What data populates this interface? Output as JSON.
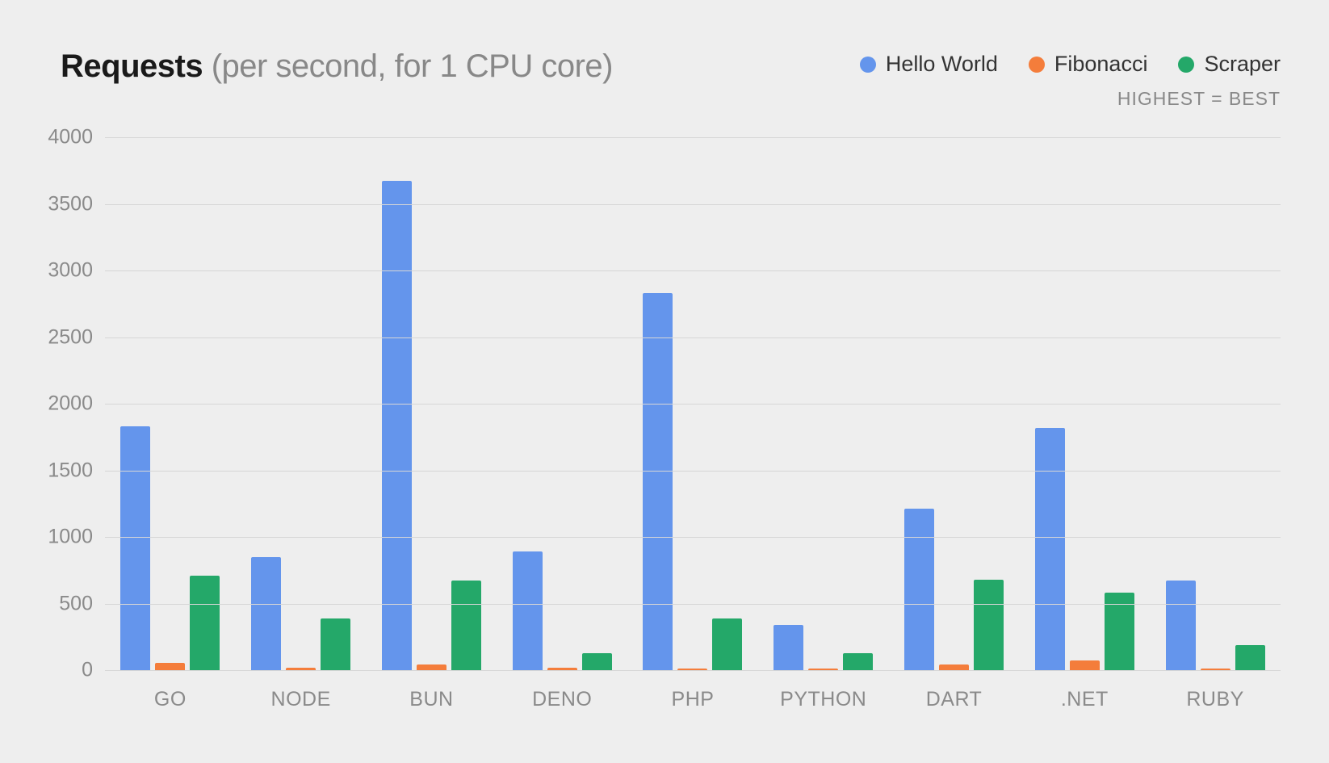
{
  "title": {
    "main": "Requests",
    "sub": "(per second, for 1 CPU core)"
  },
  "legend_note": "HIGHEST = BEST",
  "colors": {
    "hello_world": "#6495ec",
    "fibonacci": "#f47d3b",
    "scraper": "#24a869"
  },
  "chart_data": {
    "type": "bar",
    "title": "Requests (per second, for 1 CPU core)",
    "xlabel": "",
    "ylabel": "",
    "ylim": [
      0,
      4000
    ],
    "ystep": 500,
    "categories": [
      "GO",
      "NODE",
      "BUN",
      "DENO",
      "PHP",
      "PYTHON",
      "DART",
      ".NET",
      "RUBY"
    ],
    "series": [
      {
        "name": "Hello World",
        "color_key": "hello_world",
        "values": [
          1830,
          850,
          3670,
          890,
          2830,
          340,
          1210,
          1820,
          670
        ]
      },
      {
        "name": "Fibonacci",
        "color_key": "fibonacci",
        "values": [
          55,
          20,
          45,
          20,
          10,
          15,
          45,
          75,
          15
        ]
      },
      {
        "name": "Scraper",
        "color_key": "scraper",
        "values": [
          710,
          390,
          670,
          130,
          390,
          130,
          680,
          580,
          190
        ]
      }
    ]
  }
}
